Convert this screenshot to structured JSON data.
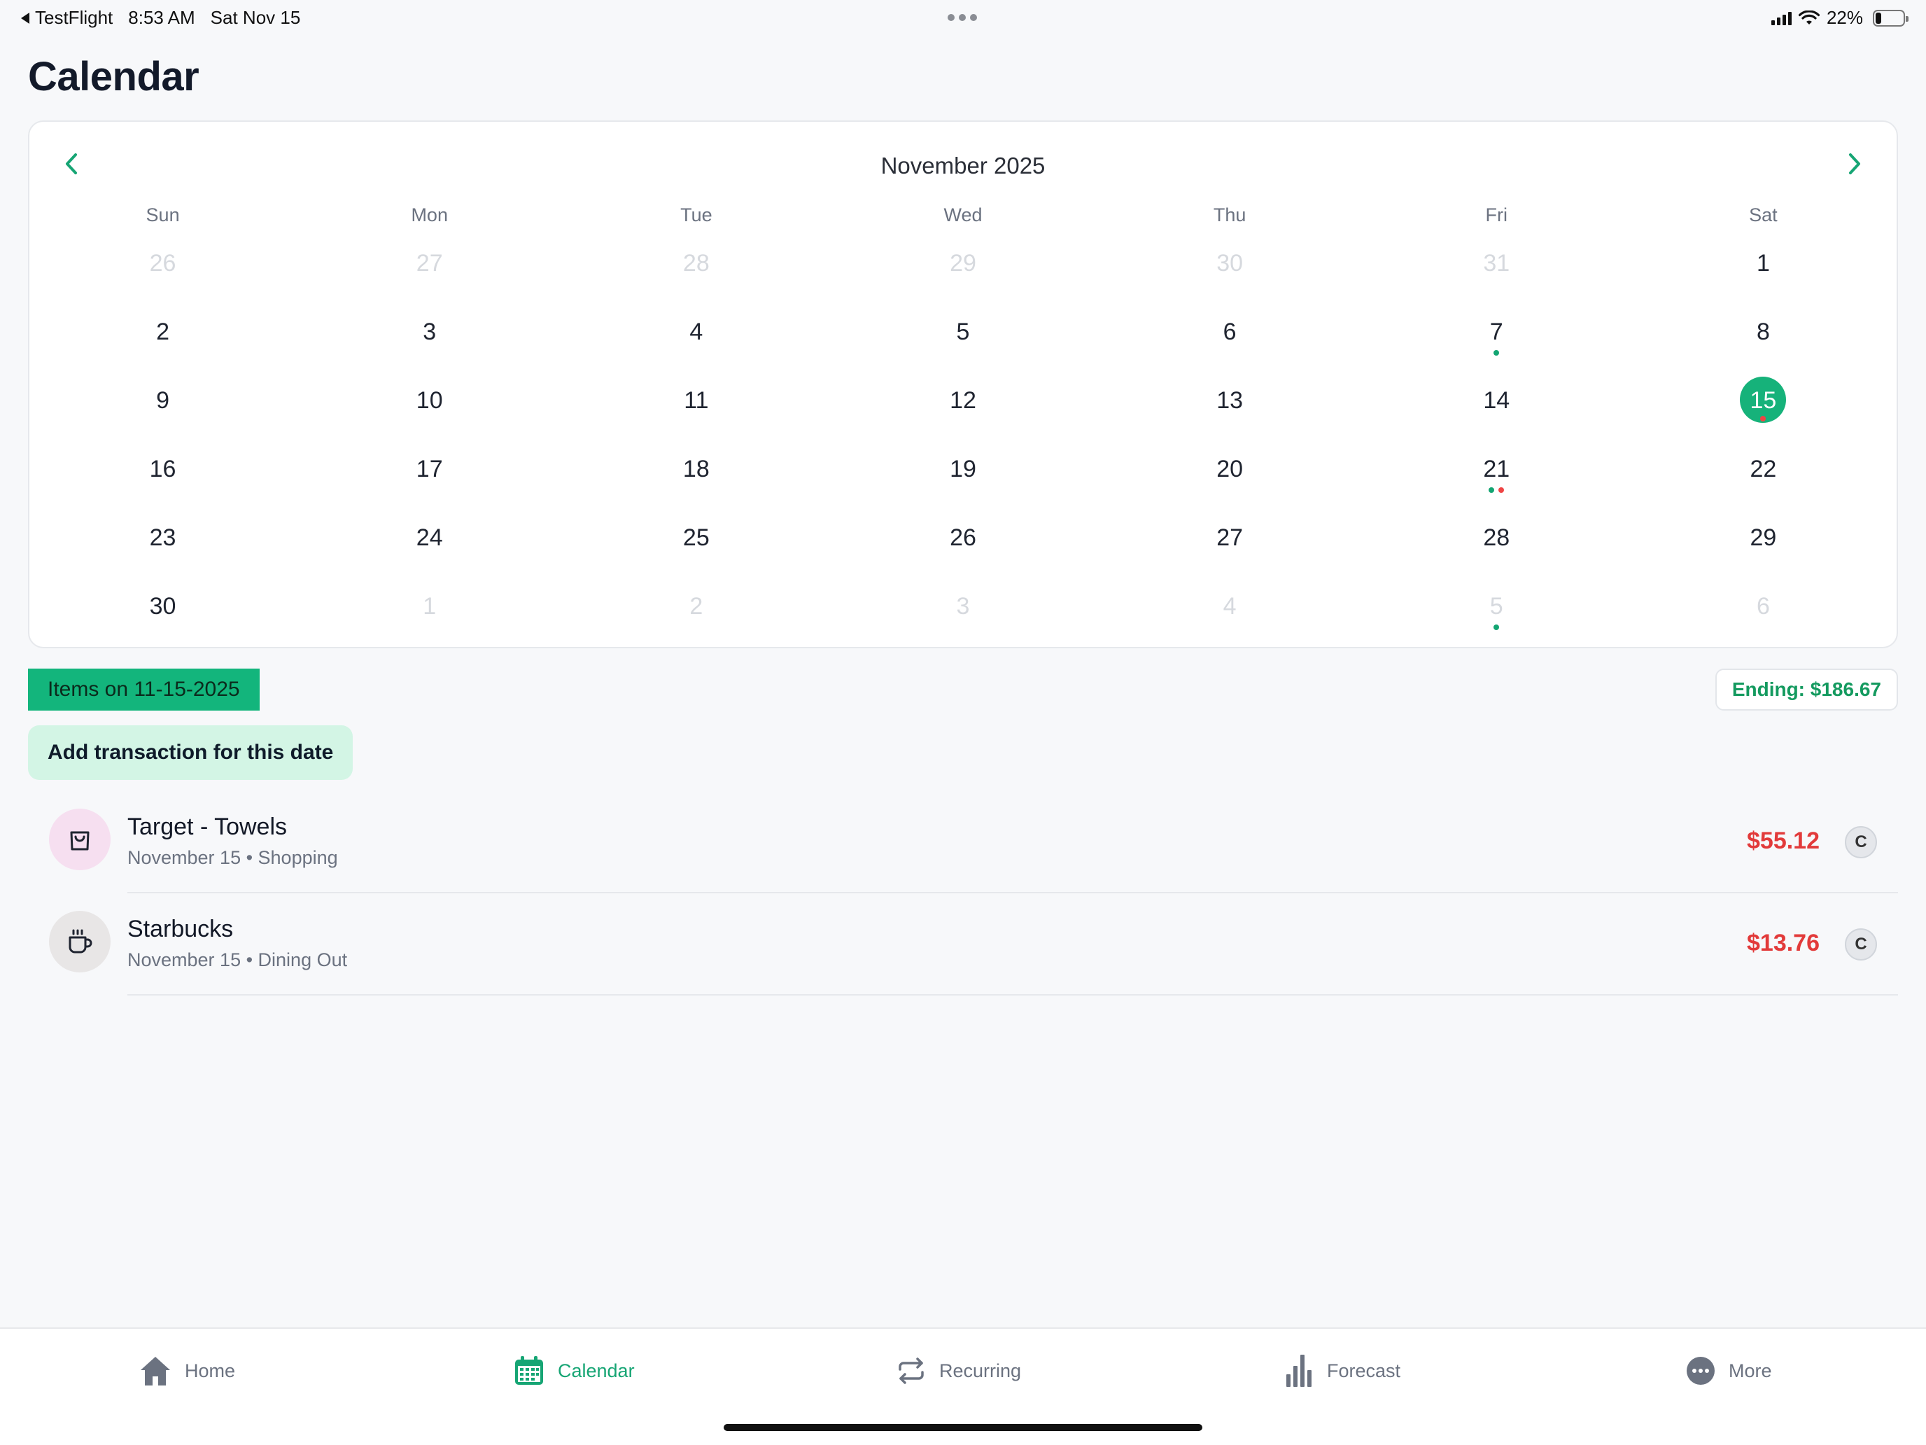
{
  "status_bar": {
    "back_app": "TestFlight",
    "time": "8:53 AM",
    "date": "Sat Nov 15",
    "battery": "22%",
    "battery_level": 0.22
  },
  "page": {
    "title": "Calendar"
  },
  "calendar": {
    "month_label": "November 2025",
    "weekdays": [
      "Sun",
      "Mon",
      "Tue",
      "Wed",
      "Thu",
      "Fri",
      "Sat"
    ],
    "weeks": [
      [
        {
          "d": "26",
          "muted": true
        },
        {
          "d": "27",
          "muted": true
        },
        {
          "d": "28",
          "muted": true
        },
        {
          "d": "29",
          "muted": true
        },
        {
          "d": "30",
          "muted": true
        },
        {
          "d": "31",
          "muted": true
        },
        {
          "d": "1"
        }
      ],
      [
        {
          "d": "2"
        },
        {
          "d": "3"
        },
        {
          "d": "4"
        },
        {
          "d": "5"
        },
        {
          "d": "6"
        },
        {
          "d": "7",
          "dots": [
            "green"
          ]
        },
        {
          "d": "8"
        }
      ],
      [
        {
          "d": "9"
        },
        {
          "d": "10"
        },
        {
          "d": "11"
        },
        {
          "d": "12"
        },
        {
          "d": "13"
        },
        {
          "d": "14"
        },
        {
          "d": "15",
          "selected": true,
          "dots": [
            "red"
          ]
        }
      ],
      [
        {
          "d": "16"
        },
        {
          "d": "17"
        },
        {
          "d": "18"
        },
        {
          "d": "19"
        },
        {
          "d": "20"
        },
        {
          "d": "21",
          "dots": [
            "green",
            "red"
          ]
        },
        {
          "d": "22"
        }
      ],
      [
        {
          "d": "23"
        },
        {
          "d": "24"
        },
        {
          "d": "25"
        },
        {
          "d": "26"
        },
        {
          "d": "27"
        },
        {
          "d": "28"
        },
        {
          "d": "29"
        }
      ],
      [
        {
          "d": "30"
        },
        {
          "d": "1",
          "muted": true
        },
        {
          "d": "2",
          "muted": true
        },
        {
          "d": "3",
          "muted": true
        },
        {
          "d": "4",
          "muted": true
        },
        {
          "d": "5",
          "muted": true,
          "dots": [
            "green"
          ]
        },
        {
          "d": "6",
          "muted": true
        }
      ]
    ]
  },
  "items": {
    "date_label": "Items on 11-15-2025",
    "ending_label": "Ending: $186.67",
    "add_button": "Add transaction for this date"
  },
  "transactions": [
    {
      "title": "Target - Towels",
      "subtitle": "November 15 • Shopping",
      "amount": "$55.12",
      "badge": "C",
      "icon": "shopping-bag-icon",
      "icon_bg": "#f6dff0"
    },
    {
      "title": "Starbucks",
      "subtitle": "November 15 • Dining Out",
      "amount": "$13.76",
      "badge": "C",
      "icon": "coffee-cup-icon",
      "icon_bg": "#e8e6e6"
    }
  ],
  "tabs": {
    "home": "Home",
    "calendar": "Calendar",
    "recurring": "Recurring",
    "forecast": "Forecast",
    "more": "More"
  },
  "colors": {
    "accent": "#16b27a",
    "expense": "#e23a3a",
    "ending": "#149a5f"
  }
}
